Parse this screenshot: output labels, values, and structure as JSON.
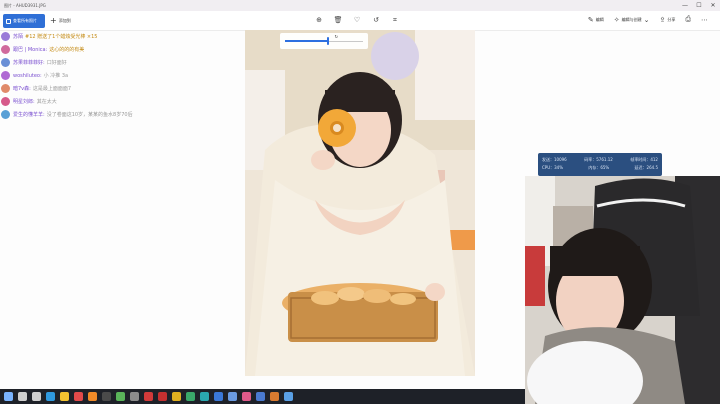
{
  "window": {
    "title": "图片 - AHUD3931.JPG",
    "controls": [
      "—",
      "☐",
      "✕"
    ]
  },
  "toolbar": {
    "see_all_label": "查看所有照片",
    "add_label": "添加到",
    "center_icons": [
      "zoom-in-icon",
      "delete-icon",
      "favorite-icon",
      "rotate-icon",
      "crop-icon"
    ],
    "edit_label": "编辑",
    "edit_create_label": "编辑与创建",
    "share_label": "分享",
    "print_glyph": "⎙",
    "more_glyph": "⋯"
  },
  "chat": [
    {
      "name": "苏陌",
      "text": "#12 赠送了1个蜡烛受光棒 ×15",
      "color": "#9a7bd8",
      "style": "gift"
    },
    {
      "name": "跟巴 | Monica:",
      "text": "这心的的的有美",
      "color": "#d06a9c",
      "style": "gold"
    },
    {
      "name": "苏果菲菲菲好:",
      "text": "口好面好",
      "color": "#6a8fd6",
      "style": "normal"
    },
    {
      "name": "woshiluteo:",
      "text": "小 冷推 3a",
      "color": "#b06ad4",
      "style": "normal"
    },
    {
      "name": "暗7v森:",
      "text": "这是最上面面面7",
      "color": "#e08a6a",
      "style": "normal"
    },
    {
      "name": "明星刘郎:",
      "text": "其在太大",
      "color": "#d65a8a",
      "style": "normal"
    },
    {
      "name": "爱生的懂羊羊:",
      "text": "没了卷面这10岁，某某的鱼水8岁70后",
      "color": "#5aa0d6",
      "style": "normal"
    }
  ],
  "photo": {
    "slider_caption": "↻",
    "zoom_level": 0.55
  },
  "stats": {
    "rows": [
      [
        "发送：10096",
        "码率：5761.12",
        "帧率时间：412"
      ],
      [
        "CPU：34%",
        "内存：65%",
        "延迟：264.5"
      ]
    ]
  },
  "taskbar": {
    "icons": [
      {
        "name": "start-icon",
        "color": "#7ab4ff"
      },
      {
        "name": "search-icon",
        "color": "#cfcfcf"
      },
      {
        "name": "task-view-icon",
        "color": "#cfcfcf"
      },
      {
        "name": "edge-icon",
        "color": "#2f9ae0"
      },
      {
        "name": "explorer-icon",
        "color": "#f2c230"
      },
      {
        "name": "app-red-icon",
        "color": "#e24a4a"
      },
      {
        "name": "app-orange-icon",
        "color": "#f08a28"
      },
      {
        "name": "app-dark-icon",
        "color": "#4a4a4a"
      },
      {
        "name": "chrome-icon",
        "color": "#5ab45a"
      },
      {
        "name": "app-grey-icon",
        "color": "#8c8c8c"
      },
      {
        "name": "app-red2-icon",
        "color": "#d23a3a"
      },
      {
        "name": "app-red3-icon",
        "color": "#c43030"
      },
      {
        "name": "app-yellow-icon",
        "color": "#e0b020"
      },
      {
        "name": "app-green-icon",
        "color": "#3aa86a"
      },
      {
        "name": "app-teal-icon",
        "color": "#2aa8b0"
      },
      {
        "name": "app-blue-icon",
        "color": "#3a78d8"
      },
      {
        "name": "app-photo-icon",
        "color": "#6a9ae0"
      },
      {
        "name": "app-music-icon",
        "color": "#e05a8a"
      },
      {
        "name": "app-store-icon",
        "color": "#4a7ad0"
      },
      {
        "name": "app-video-icon",
        "color": "#d87a30"
      },
      {
        "name": "photos-app-icon",
        "color": "#5aa0e6"
      }
    ]
  },
  "colors": {
    "accent": "#2f6fd6",
    "stats_bg": "#2b4f80",
    "taskbar_bg": "#1e2128"
  }
}
